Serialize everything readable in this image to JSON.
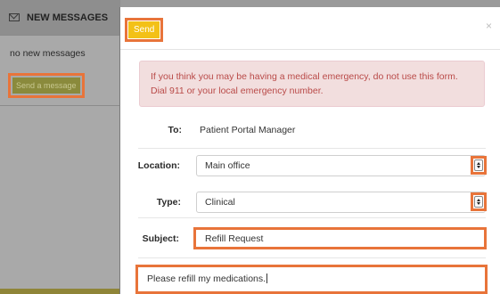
{
  "sidebar": {
    "header_title": "NEW MESSAGES",
    "empty_text": "no new messages",
    "send_message_label": "Send a message"
  },
  "modal": {
    "send_label": "Send",
    "close_label": "×",
    "alert_text": "If you think you may be having a medical emergency, do not use this form. Dial 911 or your local emergency number.",
    "to_label": "To:",
    "to_value": "Patient Portal Manager",
    "location_label": "Location:",
    "location_value": "Main office",
    "type_label": "Type:",
    "type_value": "Clinical",
    "subject_label": "Subject:",
    "subject_value": "Refill Request",
    "message_value": "Please refill my medications."
  },
  "colors": {
    "highlight": "#e8743a",
    "send_button": "#f3c117",
    "alert_background": "#f2dede",
    "alert_text": "#b94a48"
  },
  "icons": {
    "sidebar_header": "envelope-icon",
    "select_arrows": "up-down-arrows-icon"
  }
}
